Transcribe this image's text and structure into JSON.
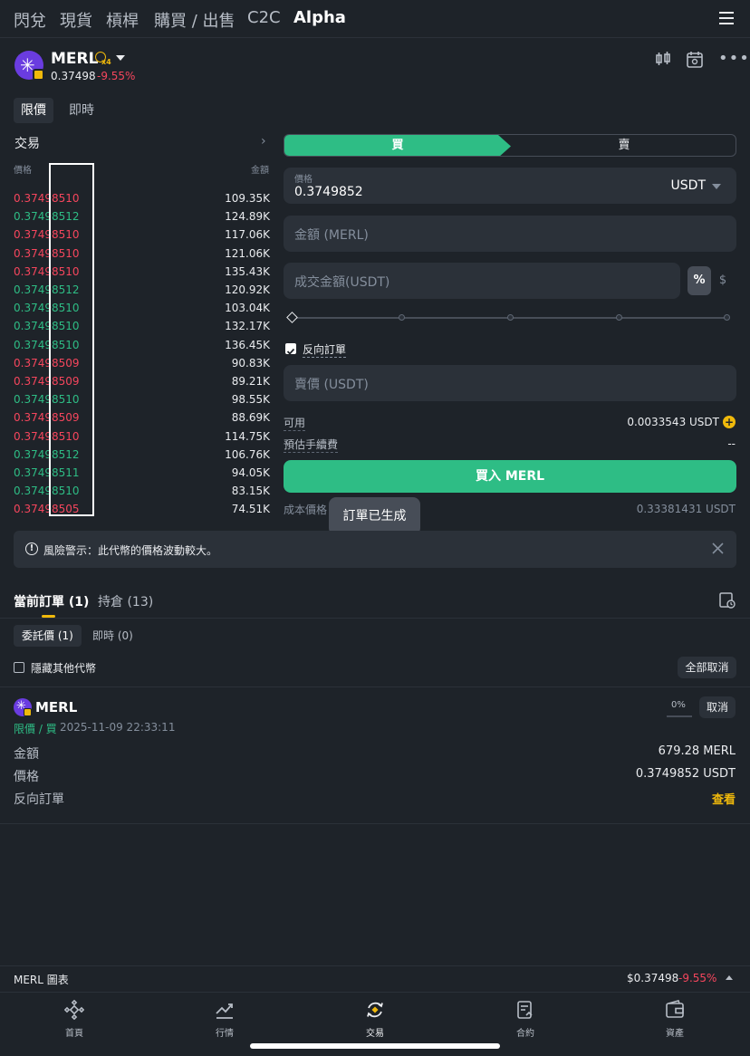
{
  "topnav": {
    "tabs": [
      "閃兌",
      "現貨",
      "槓桿",
      "購買 / 出售",
      "C2C",
      "Alpha"
    ],
    "active": "Alpha"
  },
  "token": {
    "name": "MERL",
    "multiplier": "x4",
    "price": "0.37498",
    "change": "-9.55%"
  },
  "order_types": [
    "限價",
    "即時"
  ],
  "orderbook": {
    "title": "交易",
    "price_header": "價格",
    "amount_header": "金額",
    "rows": [
      {
        "price": "0.37498510",
        "amount": "109.35K",
        "side": "sell"
      },
      {
        "price": "0.37498512",
        "amount": "124.89K",
        "side": "buy"
      },
      {
        "price": "0.37498510",
        "amount": "117.06K",
        "side": "sell"
      },
      {
        "price": "0.37498510",
        "amount": "121.06K",
        "side": "sell"
      },
      {
        "price": "0.37498510",
        "amount": "135.43K",
        "side": "sell"
      },
      {
        "price": "0.37498512",
        "amount": "120.92K",
        "side": "buy"
      },
      {
        "price": "0.37498510",
        "amount": "103.04K",
        "side": "buy"
      },
      {
        "price": "0.37498510",
        "amount": "132.17K",
        "side": "buy"
      },
      {
        "price": "0.37498510",
        "amount": "136.45K",
        "side": "buy"
      },
      {
        "price": "0.37498509",
        "amount": "90.83K",
        "side": "sell"
      },
      {
        "price": "0.37498509",
        "amount": "89.21K",
        "side": "sell"
      },
      {
        "price": "0.37498510",
        "amount": "98.55K",
        "side": "buy"
      },
      {
        "price": "0.37498509",
        "amount": "88.69K",
        "side": "sell"
      },
      {
        "price": "0.37498510",
        "amount": "114.75K",
        "side": "sell"
      },
      {
        "price": "0.37498512",
        "amount": "106.76K",
        "side": "buy"
      },
      {
        "price": "0.37498511",
        "amount": "94.05K",
        "side": "buy"
      },
      {
        "price": "0.37498510",
        "amount": "83.15K",
        "side": "buy"
      },
      {
        "price": "0.37498505",
        "amount": "74.51K",
        "side": "sell"
      }
    ]
  },
  "form": {
    "buy_label": "買",
    "sell_label": "賣",
    "price_label": "價格",
    "price_value": "0.3749852",
    "quote_currency": "USDT",
    "amount_placeholder": "金額 (MERL)",
    "total_placeholder": "成交金額(USDT)",
    "percent_toggle": "%",
    "dollar_toggle": "$",
    "reverse_order_label": "反向訂單",
    "reverse_order_checked": true,
    "sell_price_placeholder": "賣價 (USDT)",
    "available_label": "可用",
    "available_value": "0.0033543 USDT",
    "fee_label": "預估手續費",
    "fee_value": "--",
    "buy_button": "買入 MERL",
    "cost_label": "成本價格",
    "cost_value": "0.33381431 USDT"
  },
  "toast": "訂單已生成",
  "risk_warning": "風險警示：此代幣的價格波動較大。",
  "orders": {
    "tab_current": "當前訂單 (1)",
    "tab_holdings": "持倉 (13)",
    "sub_tab_limit": "委託價 (1)",
    "sub_tab_instant": "即時 (0)",
    "hide_others": "隱藏其他代幣",
    "cancel_all": "全部取消",
    "item": {
      "token": "MERL",
      "type": "限價 / 買",
      "time": "2025-11-09 22:33:11",
      "progress": "0%",
      "cancel": "取消",
      "amount_label": "金額",
      "amount_value": "679.28 MERL",
      "price_label": "價格",
      "price_value": "0.3749852 USDT",
      "reverse_label": "反向訂單",
      "reverse_link": "查看"
    }
  },
  "chart_bar": {
    "label": "MERL 圖表",
    "price": "$0.37498",
    "change": "-9.55%"
  },
  "bottom_nav": [
    "首頁",
    "行情",
    "交易",
    "合約",
    "資產"
  ],
  "colors": {
    "buy": "#2ebd85",
    "sell": "#f6465d",
    "accent": "#f0b90b",
    "background": "#1e2329"
  }
}
